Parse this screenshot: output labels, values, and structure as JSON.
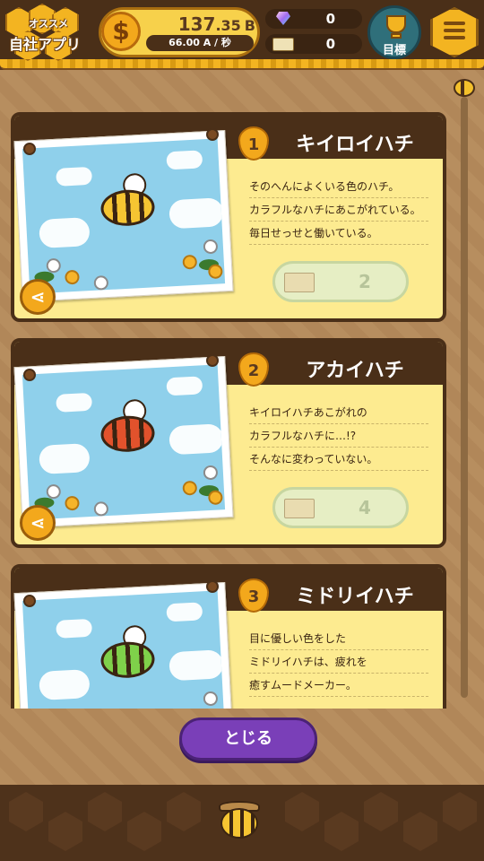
{
  "header": {
    "promo_top": "オススメ",
    "promo_main": "自社アプリ",
    "money_symbol": "$",
    "money_int": "137",
    "money_dec": ".35",
    "money_unit": "B",
    "money_rate": "66.00 A / 秒",
    "gems": "0",
    "tickets": "0",
    "goal_label": "目標"
  },
  "bees": [
    {
      "rank": "1",
      "name": "キイロイハチ",
      "desc": [
        "そのへんによくいる色のハチ。",
        "カラフルなハチにあこがれている。",
        "毎日せっせと働いている。"
      ],
      "cost": "2",
      "color": "#f6c532"
    },
    {
      "rank": "2",
      "name": "アカイハチ",
      "desc": [
        "キイロイハチあこがれの",
        "カラフルなハチに…!?",
        "そんなに変わっていない。"
      ],
      "cost": "4",
      "color": "#e2522c"
    },
    {
      "rank": "3",
      "name": "ミドリイハチ",
      "desc": [
        "目に優しい色をした",
        "ミドリイハチは、疲れを",
        "癒すムードメーカー。"
      ],
      "cost": "",
      "color": "#7fd14a"
    }
  ],
  "footer": {
    "close_label": "とじる"
  },
  "icons": {
    "coin": "dollar-coin-icon",
    "gem": "diamond-icon",
    "ticket": "ticket-icon",
    "goal": "trophy-icon",
    "menu": "hamburger-menu-icon",
    "share": "share-icon"
  }
}
